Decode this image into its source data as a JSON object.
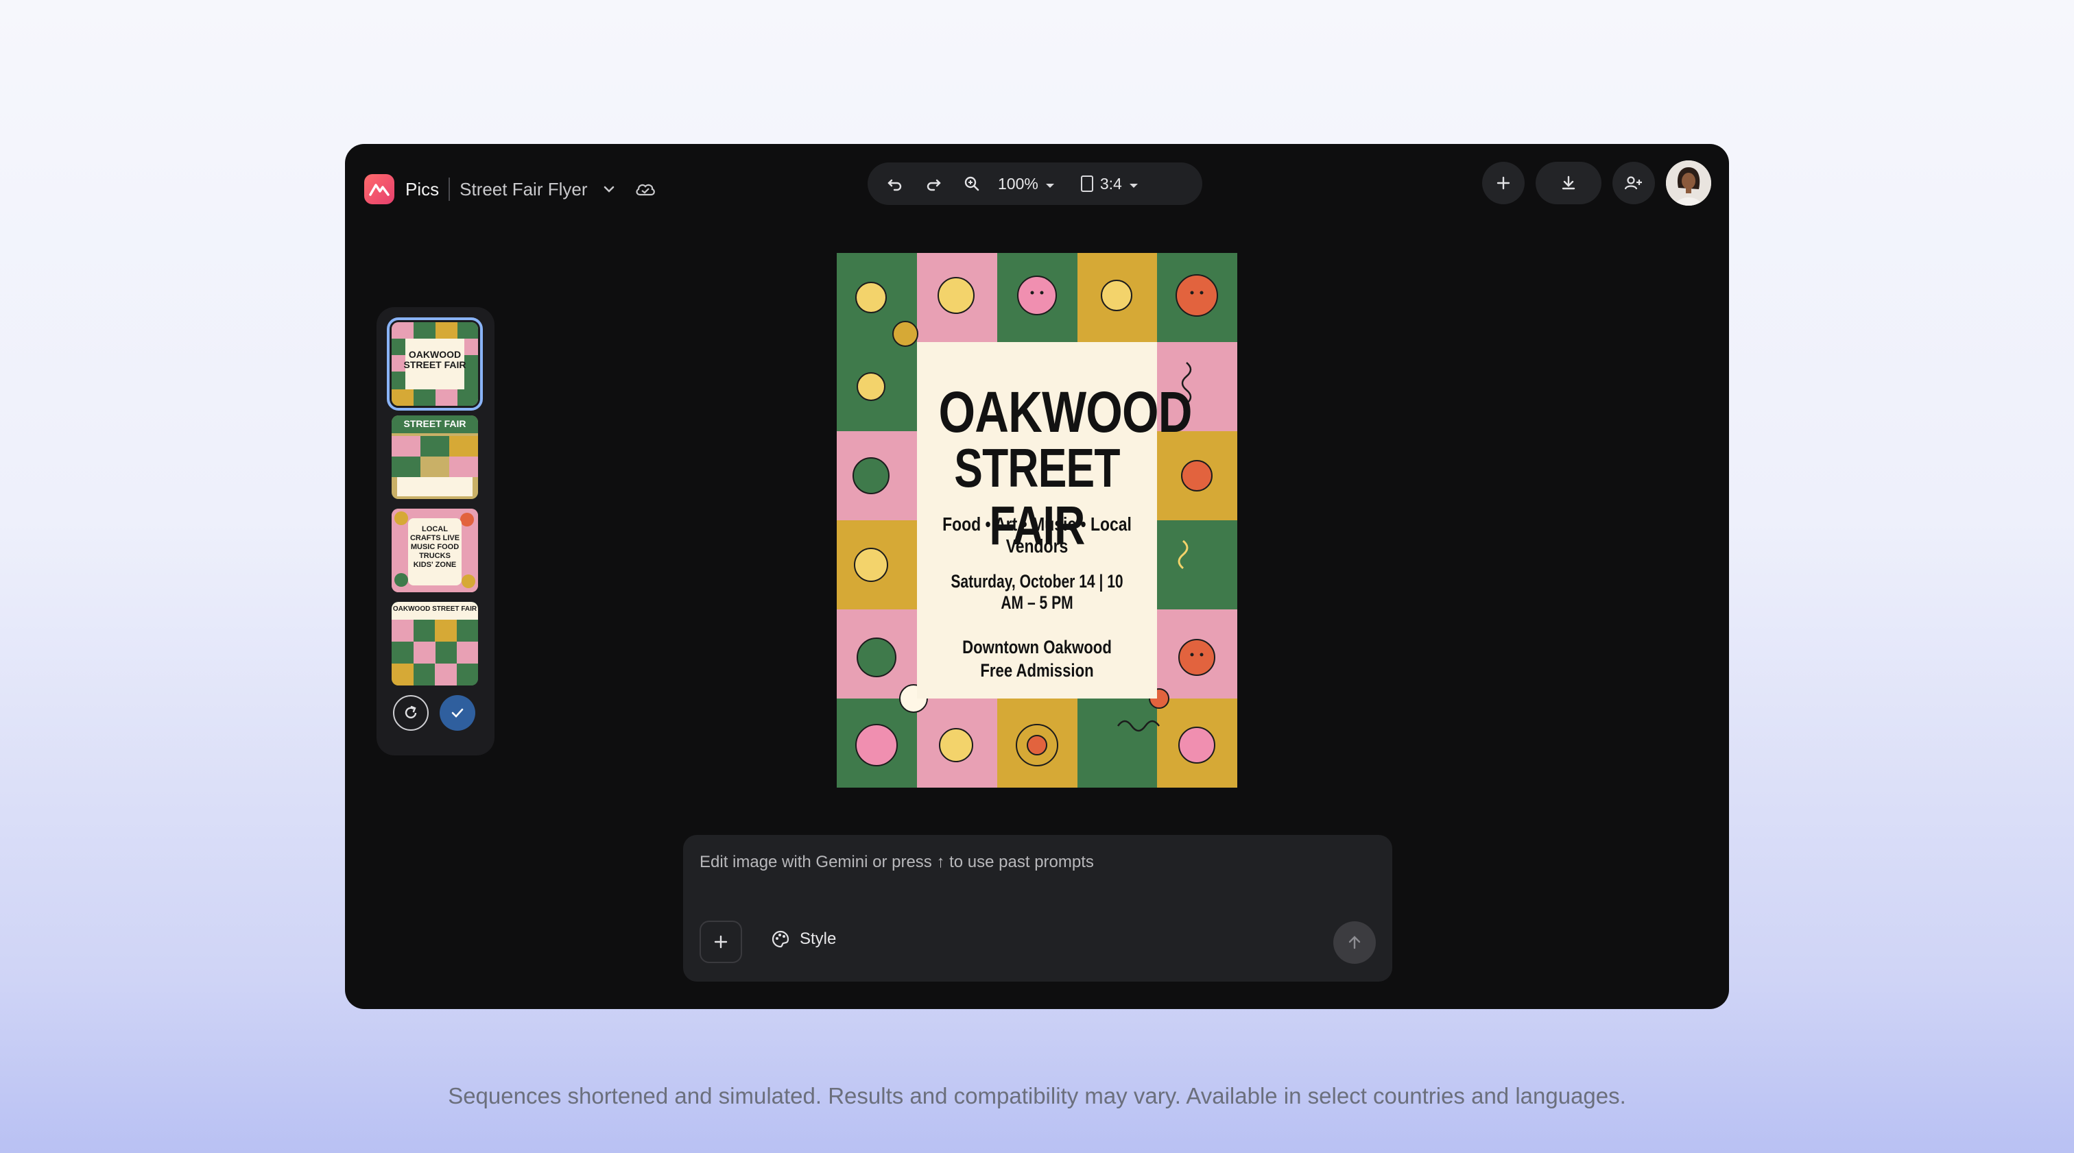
{
  "app": {
    "name": "Pics",
    "document_title": "Street Fair Flyer"
  },
  "toolbar": {
    "zoom": "100%",
    "aspect_ratio": "3:4"
  },
  "flyer": {
    "title_line1": "OAKWOOD",
    "title_line2": "STREET FAIR",
    "tagline": "Food • Art • Music • Local Vendors",
    "date": "Saturday, October 14 | 10 AM – 5 PM",
    "location": "Downtown Oakwood",
    "admission": "Free Admission"
  },
  "thumbnails": [
    {
      "label": "OAKWOOD STREET FAIR",
      "selected": true
    },
    {
      "label": "STREET FAIR",
      "selected": false
    },
    {
      "label": "LOCAL CRAFTS LIVE MUSIC FOOD TRUCKS KIDS' ZONE",
      "selected": false
    },
    {
      "label": "OAKWOOD STREET FAIR",
      "selected": false
    }
  ],
  "prompt": {
    "placeholder": "Edit image with Gemini or press ↑ to use past prompts",
    "style_label": "Style"
  },
  "disclaimer": "Sequences shortened and simulated. Results and compatibility may vary. Available in select countries and languages.",
  "colors": {
    "window_bg": "#0e0e0f",
    "accent_blue": "#2f5f9e",
    "selected_outline": "#8ab4f8",
    "tile_green": "#3f7a4b",
    "tile_pink": "#e8a0b4",
    "tile_gold": "#d6a936",
    "poster_cream": "#fbf3e1"
  },
  "icons": [
    "pics-logo-icon",
    "chevron-down-icon",
    "cloud-icon",
    "undo-icon",
    "redo-icon",
    "zoom-in-icon",
    "caret-down-icon",
    "aspect-ratio-icon",
    "plus-icon",
    "download-icon",
    "share-person-icon",
    "avatar",
    "regenerate-icon",
    "check-icon",
    "palette-icon",
    "send-arrow-icon"
  ]
}
